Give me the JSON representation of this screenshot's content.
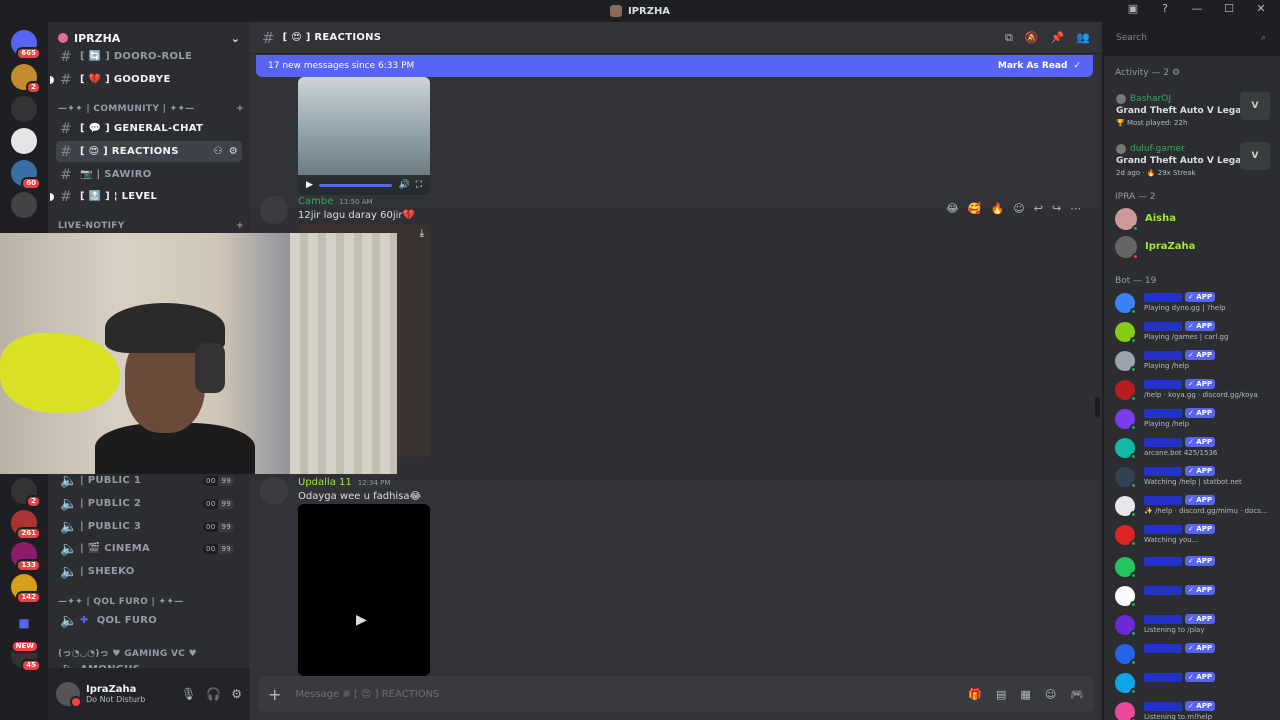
{
  "window": {
    "title": "IPRZHA"
  },
  "rail": {
    "badges": [
      "665",
      "2",
      "60",
      "2",
      "261",
      "133",
      "142",
      "45"
    ],
    "new_label": "NEW"
  },
  "server": {
    "name": "IPRZHA"
  },
  "channels": {
    "doorol": "[ 🔄 ] DOORO-ROLE",
    "goodbye": "[ 💔 ] GOODBYE",
    "community_cat": "—✦✦ | COMMUNITY | ✦✦—",
    "general": "[ 💬 ] GENERAL-CHAT",
    "reactions": "[ 😍 ] REACTIONS",
    "sawiro": "📷 | SAWIRO",
    "level": "[ 🔝 ] ¦ LEVEL",
    "live_cat": "LIVE-NOTIFY",
    "public1": "| PUBLIC 1",
    "public2": "| PUBLIC 2",
    "public3": "| PUBLIC 3",
    "cinema": "| 🎬 CINEMA",
    "sheeko": "| SHEEKO",
    "qol_cat": "—✦✦ | QOL FURO | ✦✦—",
    "qol": "QOL FURO",
    "gaming_cat": "(っ◔◡◔)っ ♥ GAMING VC ♥",
    "amongus": "AMONGUS",
    "voice_left": "00",
    "voice_right": "99"
  },
  "user": {
    "name": "IpraZaha",
    "status": "Do Not Disturb"
  },
  "chat": {
    "channel": "[ 😍 ] REACTIONS",
    "new_messages": "17 new messages since 6:33 PM",
    "mark_read": "Mark As Read",
    "messages": [
      {
        "author": "Cambe",
        "time": "11:50 AM",
        "text": "12jir lagu daray 60jir💔"
      },
      {
        "author": "Updalla 11",
        "time": "12:34 PM",
        "text": "Odayga wee u fadhisa😂"
      }
    ],
    "composer_placeholder": "Message # [ 😍 ] REACTIONS"
  },
  "search": {
    "placeholder": "Search"
  },
  "members": {
    "activity_header": "Activity — 2",
    "activities": [
      {
        "name": "BasharOJ",
        "game": "Grand Theft Auto V Legacy",
        "meta": "🏆 Most played: 22h",
        "logo": "V"
      },
      {
        "name": "duluf-gamer",
        "game": "Grand Theft Auto V Legacy",
        "meta": "2d ago · 🔥 29x Streak",
        "logo": "V"
      }
    ],
    "ipra_header": "IPRA — 2",
    "ipra": [
      {
        "name": "Aisha",
        "color": "#a3e635"
      },
      {
        "name": "IpraZaha",
        "color": "#a3e635"
      }
    ],
    "bot_header": "Bot — 19",
    "app_tag": "✓ APP",
    "bots": [
      {
        "activity": "Playing dyno.gg | ?help",
        "color": "#3b82f6"
      },
      {
        "activity": "Playing /games | carl.gg",
        "color": "#84cc16"
      },
      {
        "activity": "Playing /help",
        "color": "#9ca3af"
      },
      {
        "activity": "/help · koya.gg · discord.gg/koya",
        "color": "#b91c1c"
      },
      {
        "activity": "Playing /help",
        "color": "#7c3aed"
      },
      {
        "activity": "arcane.bot 425/1536",
        "color": "#14b8a6"
      },
      {
        "activity": "Watching /help | statbot.net",
        "color": "#334155"
      },
      {
        "activity": "✨ /help · discord.gg/mimu · docs...",
        "color": "#e5e7eb"
      },
      {
        "activity": "Watching you...",
        "color": "#dc2626"
      },
      {
        "activity": "",
        "color": "#22c55e"
      },
      {
        "activity": "",
        "color": "#f8fafc"
      },
      {
        "activity": "Listening to /play",
        "color": "#6d28d9"
      },
      {
        "activity": "",
        "color": "#2563eb"
      },
      {
        "activity": "",
        "color": "#0ea5e9"
      },
      {
        "activity": "Listening to m!help",
        "color": "#ec4899"
      }
    ]
  }
}
